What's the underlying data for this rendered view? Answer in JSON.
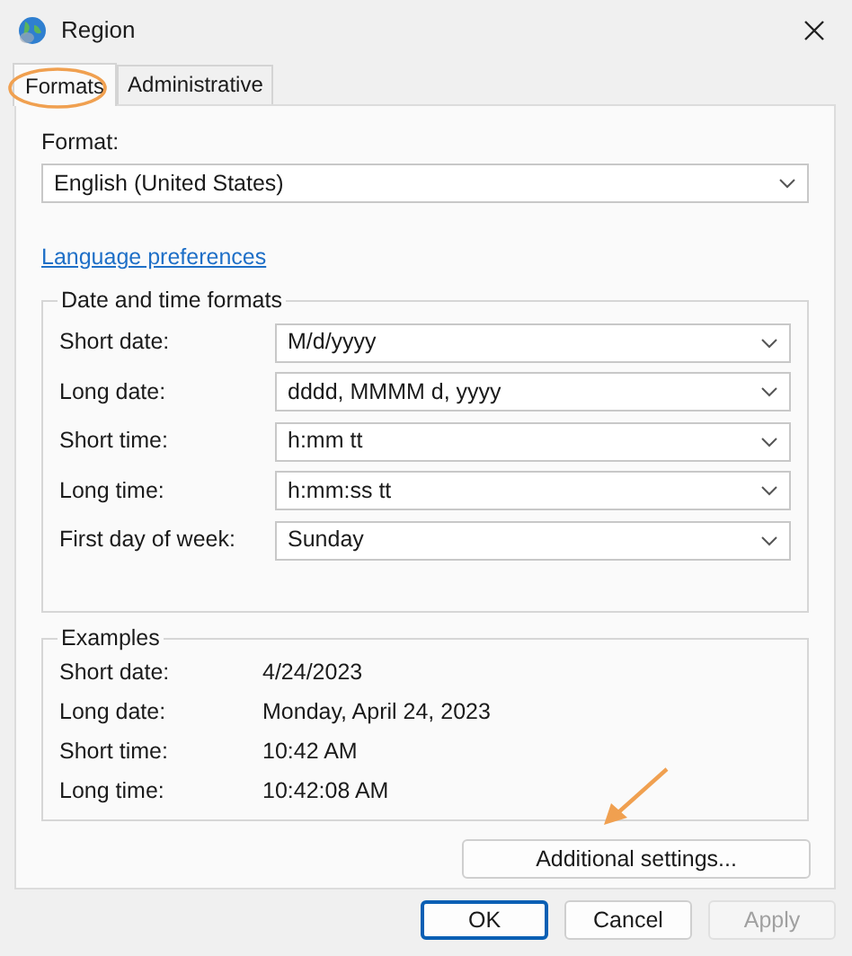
{
  "window": {
    "title": "Region"
  },
  "tabs": [
    {
      "label": "Formats",
      "selected": true
    },
    {
      "label": "Administrative",
      "selected": false
    }
  ],
  "format": {
    "label": "Format:",
    "value": "English (United States)"
  },
  "language_link": "Language preferences",
  "date_time_formats": {
    "title": "Date and time formats",
    "fields": [
      {
        "label": "Short date:",
        "value": "M/d/yyyy"
      },
      {
        "label": "Long date:",
        "value": "dddd, MMMM d, yyyy"
      },
      {
        "label": "Short time:",
        "value": "h:mm tt"
      },
      {
        "label": "Long time:",
        "value": "h:mm:ss tt"
      },
      {
        "label": "First day of week:",
        "value": "Sunday"
      }
    ]
  },
  "examples": {
    "title": "Examples",
    "rows": [
      {
        "label": "Short date:",
        "value": "4/24/2023"
      },
      {
        "label": "Long date:",
        "value": "Monday, April 24, 2023"
      },
      {
        "label": "Short time:",
        "value": "10:42 AM"
      },
      {
        "label": "Long time:",
        "value": "10:42:08 AM"
      }
    ]
  },
  "additional_button": "Additional settings...",
  "buttons": [
    {
      "label": "OK",
      "default": true,
      "disabled": false
    },
    {
      "label": "Cancel",
      "default": false,
      "disabled": false
    },
    {
      "label": "Apply",
      "default": false,
      "disabled": true
    }
  ]
}
